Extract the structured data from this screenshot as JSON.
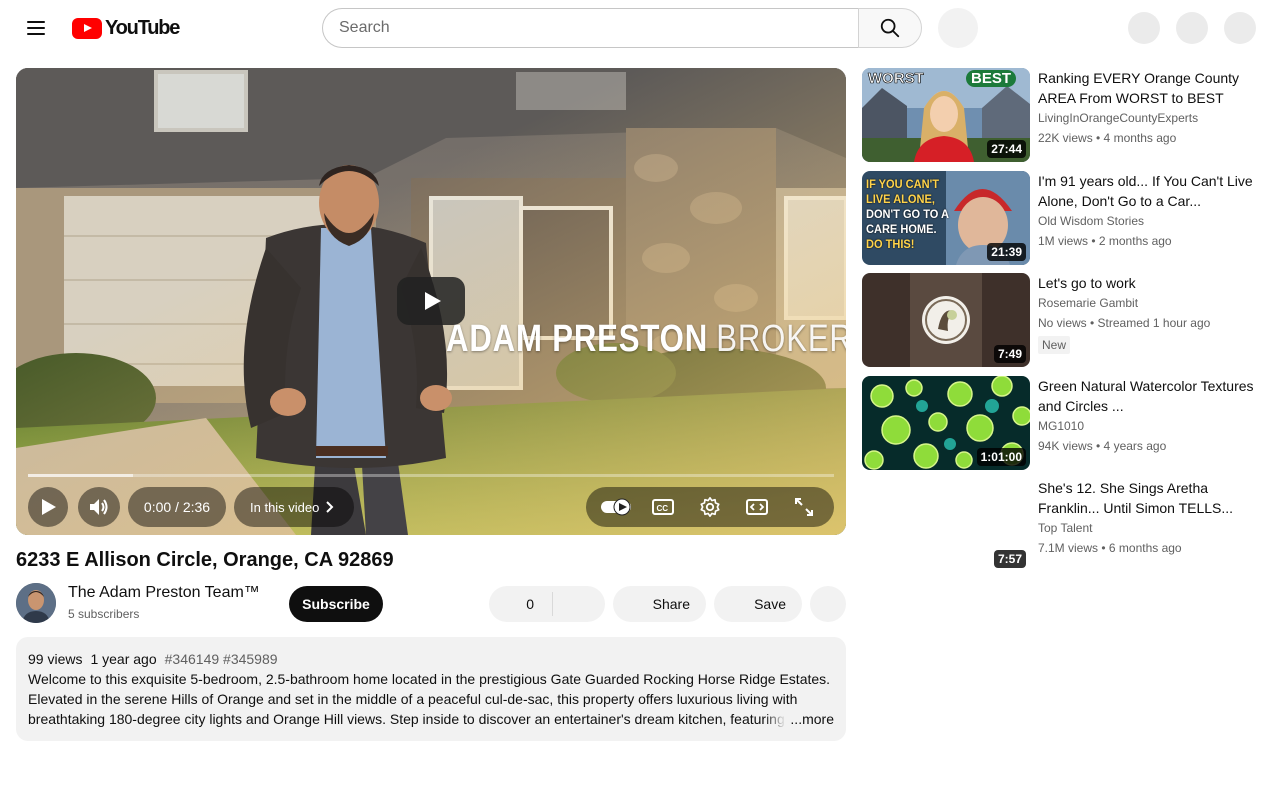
{
  "header": {
    "logo_text": "YouTube",
    "search_placeholder": "Search"
  },
  "player": {
    "overlay_name": "ADAM PRESTON",
    "overlay_role": "BROKER",
    "time": "0:00 / 2:36",
    "chapters_label": "In this video",
    "buffered_fraction": 0.13
  },
  "video": {
    "title": "6233 E Allison Circle, Orange, CA 92869",
    "channel_name": "The Adam Preston Team™",
    "subscribers": "5 subscribers",
    "subscribe_label": "Subscribe",
    "likes": "0",
    "share_label": "Share",
    "save_label": "Save"
  },
  "description": {
    "views": "99 views",
    "date": "1 year ago",
    "tags": "#346149 #345989",
    "text": "Welcome to this exquisite 5-bedroom, 2.5-bathroom home located in the prestigious Gate Guarded Rocking Horse Ridge Estates. Elevated in the serene Hills of Orange and set in the middle of a peaceful cul-de-sac, this property offers luxurious living with breathtaking 180-degree city lights and Orange Hill views. Step inside to discover an entertainer's dream kitchen, featuring",
    "more_label": "...more"
  },
  "recommendations": [
    {
      "title": "Ranking EVERY Orange County AREA From WORST to BEST",
      "channel": "LivingInOrangeCountyExperts",
      "stats": "22K views • 4 months ago",
      "duration": "27:44",
      "thumb_text_left": "WORST",
      "thumb_text_right": "BEST"
    },
    {
      "title": "I'm 91 years old... If You Can't Live Alone, Don't Go to a Car...",
      "channel": "Old Wisdom Stories",
      "stats": "1M views • 2 months ago",
      "duration": "21:39",
      "thumb_lines": [
        "IF YOU CAN'T",
        "LIVE ALONE,",
        "DON'T GO TO A",
        "CARE HOME.",
        "DO THIS!"
      ]
    },
    {
      "title": "Let's go to work",
      "channel": "Rosemarie Gambit",
      "stats": "No views • Streamed 1 hour ago",
      "duration": "7:49",
      "badge": "New"
    },
    {
      "title": "Green Natural Watercolor Textures and Circles ...",
      "channel": "MG1010",
      "stats": "94K views • 4 years ago",
      "duration": "1:01:00"
    },
    {
      "title": "She's 12. She Sings Aretha Franklin... Until Simon TELLS...",
      "channel": "Top Talent",
      "stats": "7.1M views • 6 months ago",
      "duration": "7:57"
    }
  ],
  "colors": {
    "brand_red": "#ff0000",
    "text_primary": "#0f0f0f",
    "text_secondary": "#606060",
    "chip_bg": "#f2f2f2"
  }
}
